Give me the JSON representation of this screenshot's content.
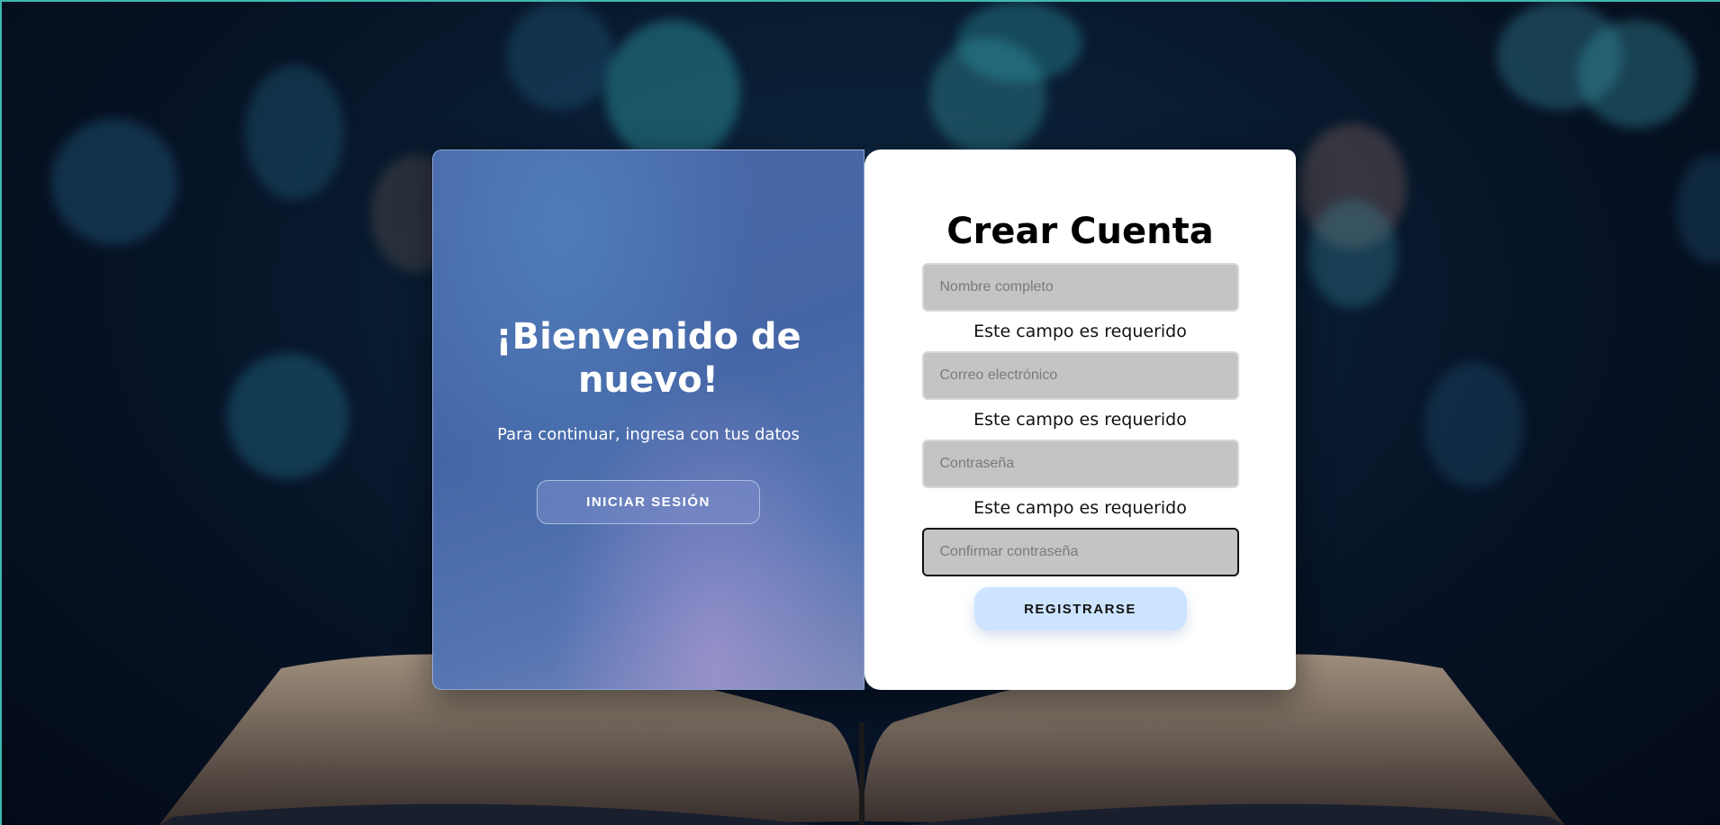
{
  "left_panel": {
    "title": "¡Bienvenido de nuevo!",
    "subtitle": "Para continuar, ingresa con tus datos",
    "login_button": "INICIAR SESIÓN"
  },
  "right_panel": {
    "title": "Crear Cuenta",
    "fields": [
      {
        "placeholder": "Nombre completo",
        "error": "Este campo es requerido"
      },
      {
        "placeholder": "Correo electrónico",
        "error": "Este campo es requerido"
      },
      {
        "placeholder": "Contraseña",
        "error": "Este campo es requerido"
      },
      {
        "placeholder": "Confirmar contraseña"
      }
    ],
    "register_button": "REGISTRARSE"
  },
  "colors": {
    "accent_border": "#3fb9b0",
    "left_panel": "#4566a6",
    "input_bg": "#c4c4c4",
    "register_button": "#cce4ff"
  }
}
